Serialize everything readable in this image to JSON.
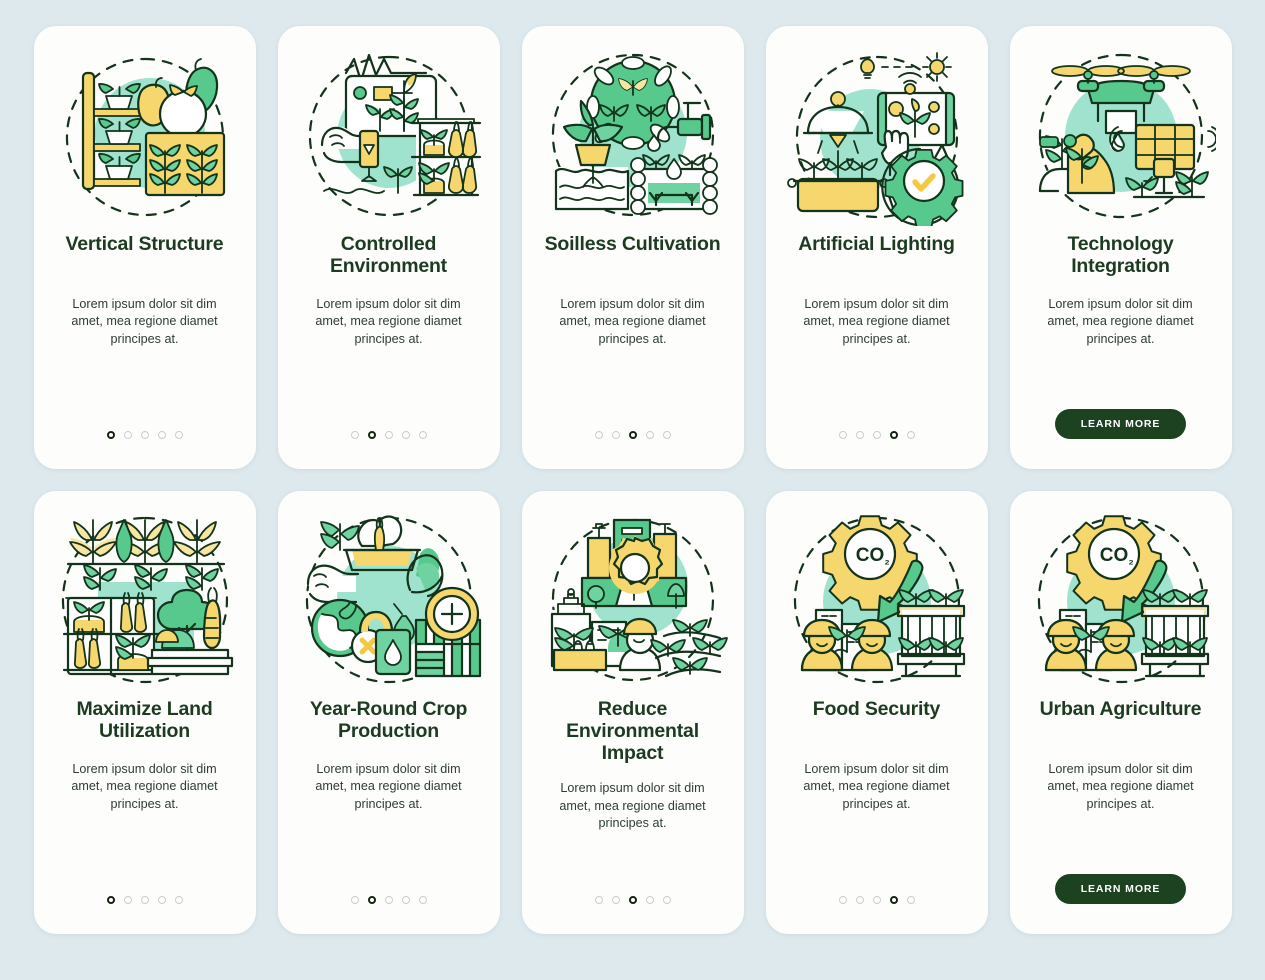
{
  "page": {
    "background_color": "#dde9ed",
    "card_background": "#fdfdfc",
    "accent_dark_green": "#1d4220",
    "accent_green": "#57c98c",
    "accent_mint": "#a8e6cf",
    "accent_yellow": "#f5d76e",
    "title_color": "#1d3b21",
    "body_color": "#2e3d33"
  },
  "body_text": "Lorem ipsum dolor sit dim amet, mea regione diamet principes at.",
  "learn_more_label": "LEARN MORE",
  "dot_count": 5,
  "cards": [
    {
      "title": "Vertical Structure",
      "illustration": "vertical-structure-illustration",
      "active_dot": 1,
      "footer": "dots"
    },
    {
      "title": "Controlled Environment",
      "illustration": "controlled-environment-illustration",
      "active_dot": 2,
      "footer": "dots"
    },
    {
      "title": "Soilless Cultivation",
      "illustration": "soilless-cultivation-illustration",
      "active_dot": 3,
      "footer": "dots"
    },
    {
      "title": "Artificial Lighting",
      "illustration": "artificial-lighting-illustration",
      "active_dot": 4,
      "footer": "dots"
    },
    {
      "title": "Technology Integration",
      "illustration": "technology-integration-illustration",
      "active_dot": 5,
      "footer": "button"
    },
    {
      "title": "Maximize Land Utilization",
      "illustration": "maximize-land-utilization-illustration",
      "active_dot": 1,
      "footer": "dots"
    },
    {
      "title": "Year-Round Crop Production",
      "illustration": "year-round-crop-production-illustration",
      "active_dot": 2,
      "footer": "dots"
    },
    {
      "title": "Reduce Environmental Impact",
      "illustration": "reduce-environmental-impact-illustration",
      "active_dot": 3,
      "footer": "dots"
    },
    {
      "title": "Food Security",
      "illustration": "food-security-illustration",
      "active_dot": 4,
      "footer": "dots"
    },
    {
      "title": "Urban Agriculture",
      "illustration": "urban-agriculture-illustration",
      "active_dot": 5,
      "footer": "button"
    }
  ]
}
